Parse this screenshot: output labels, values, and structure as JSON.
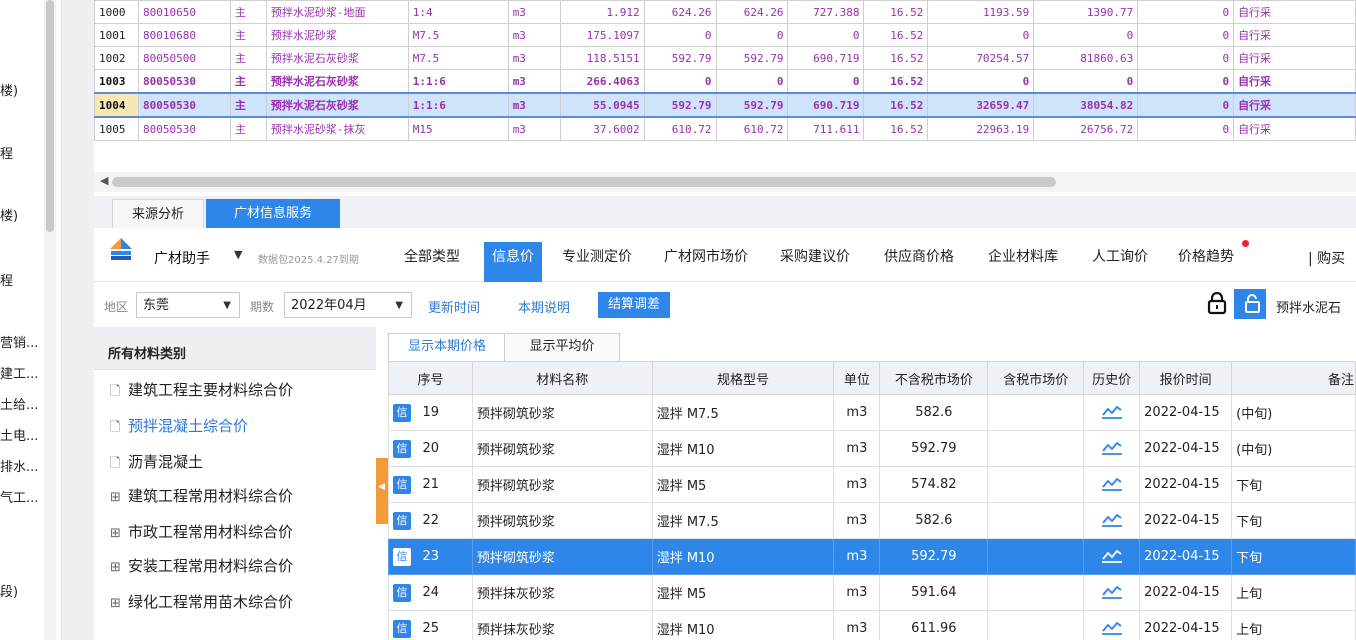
{
  "left_strip": {
    "labels": [
      "楼)",
      "程",
      "楼)",
      "程",
      "营销...",
      "建工...",
      "土给...",
      "土电...",
      "排水...",
      "气工...",
      "段)"
    ]
  },
  "top_grid": {
    "rows": [
      {
        "seq": "1000",
        "code": "80010650",
        "type": "主",
        "name": "预拌水泥砂浆-地面",
        "spec": "1:4",
        "unit": "m3",
        "qty": "1.912",
        "v1": "624.26",
        "v2": "624.26",
        "v3": "727.388",
        "v4": "16.52",
        "v5": "1193.59",
        "v6": "1390.77",
        "v7": "0",
        "note": "自行采"
      },
      {
        "seq": "1001",
        "code": "80010680",
        "type": "主",
        "name": "预拌水泥砂浆",
        "spec": "M7.5",
        "unit": "m3",
        "qty": "175.1097",
        "v1": "0",
        "v2": "0",
        "v3": "0",
        "v4": "16.52",
        "v5": "0",
        "v6": "0",
        "v7": "0",
        "note": "自行采"
      },
      {
        "seq": "1002",
        "code": "80050500",
        "type": "主",
        "name": "预拌水泥石灰砂浆",
        "spec": "M7.5",
        "unit": "m3",
        "qty": "118.5151",
        "v1": "592.79",
        "v2": "592.79",
        "v3": "690.719",
        "v4": "16.52",
        "v5": "70254.57",
        "v6": "81860.63",
        "v7": "0",
        "note": "自行采"
      },
      {
        "seq": "1003",
        "code": "80050530",
        "type": "主",
        "name": "预拌水泥石灰砂浆",
        "spec": "1:1:6",
        "unit": "m3",
        "qty": "266.4063",
        "v1": "0",
        "v2": "0",
        "v3": "0",
        "v4": "16.52",
        "v5": "0",
        "v6": "0",
        "v7": "0",
        "note": "自行采"
      },
      {
        "seq": "1004",
        "code": "80050530",
        "type": "主",
        "name": "预拌水泥石灰砂浆",
        "spec": "1:1:6",
        "unit": "m3",
        "qty": "55.0945",
        "v1": "592.79",
        "v2": "592.79",
        "v3": "690.719",
        "v4": "16.52",
        "v5": "32659.47",
        "v6": "38054.82",
        "v7": "0",
        "note": "自行采"
      },
      {
        "seq": "1005",
        "code": "80050530",
        "type": "主",
        "name": "预拌水泥砂浆-抹灰",
        "spec": "M15",
        "unit": "m3",
        "qty": "37.6002",
        "v1": "610.72",
        "v2": "610.72",
        "v3": "711.611",
        "v4": "16.52",
        "v5": "22963.19",
        "v6": "26756.72",
        "v7": "0",
        "note": "自行采"
      }
    ],
    "bold_rows": [
      3,
      4
    ],
    "selected_row": 4
  },
  "bottom_tabs": {
    "source": "来源分析",
    "guangcai": "广材信息服务"
  },
  "toolbar": {
    "app_name": "广材助手",
    "dropdown_caret": "▼",
    "package_info": "数据包2025.4.27到期",
    "nav": [
      "全部类型",
      "信息价",
      "专业测定价",
      "广材网市场价",
      "采购建议价",
      "供应商价格",
      "企业材料库",
      "人工询价",
      "价格趋势"
    ],
    "active_nav": 1,
    "buy_label": "| 购买"
  },
  "filter": {
    "region_label": "地区",
    "region_value": "东莞",
    "period_label": "期数",
    "period_value": "2022年04月",
    "update_time": "更新时间",
    "period_note": "本期说明",
    "settle_adjust": "结算调差",
    "search_text": "预拌水泥石"
  },
  "category": {
    "header": "所有材料类别",
    "items": [
      {
        "icon": "🗋",
        "label": "建筑工程主要材料综合价"
      },
      {
        "icon": "🗋",
        "label": "预拌混凝土综合价"
      },
      {
        "icon": "🗋",
        "label": "沥青混凝土"
      },
      {
        "icon": "⊞",
        "label": "建筑工程常用材料综合价"
      },
      {
        "icon": "⊞",
        "label": "市政工程常用材料综合价"
      },
      {
        "icon": "⊞",
        "label": "安装工程常用材料综合价"
      },
      {
        "icon": "⊞",
        "label": "绿化工程常用苗木综合价"
      }
    ],
    "highlight_index": 1
  },
  "price_table": {
    "subtabs": [
      "显示本期价格",
      "显示平均价"
    ],
    "headers": [
      "序号",
      "材料名称",
      "规格型号",
      "单位",
      "不含税市场价",
      "含税市场价",
      "历史价",
      "报价时间",
      "备注"
    ],
    "badge": "信",
    "rows": [
      {
        "seq": "19",
        "name": "预拌砌筑砂浆",
        "spec": "湿拌 M7.5",
        "unit": "m3",
        "price": "582.6",
        "tax_price": "",
        "date": "2022-04-15",
        "note": "(中旬)"
      },
      {
        "seq": "20",
        "name": "预拌砌筑砂浆",
        "spec": "湿拌 M10",
        "unit": "m3",
        "price": "592.79",
        "tax_price": "",
        "date": "2022-04-15",
        "note": "(中旬)"
      },
      {
        "seq": "21",
        "name": "预拌砌筑砂浆",
        "spec": "湿拌 M5",
        "unit": "m3",
        "price": "574.82",
        "tax_price": "",
        "date": "2022-04-15",
        "note": "下旬"
      },
      {
        "seq": "22",
        "name": "预拌砌筑砂浆",
        "spec": "湿拌 M7.5",
        "unit": "m3",
        "price": "582.6",
        "tax_price": "",
        "date": "2022-04-15",
        "note": "下旬"
      },
      {
        "seq": "23",
        "name": "预拌砌筑砂浆",
        "spec": "湿拌 M10",
        "unit": "m3",
        "price": "592.79",
        "tax_price": "",
        "date": "2022-04-15",
        "note": "下旬"
      },
      {
        "seq": "24",
        "name": "预拌抹灰砂浆",
        "spec": "湿拌 M5",
        "unit": "m3",
        "price": "591.64",
        "tax_price": "",
        "date": "2022-04-15",
        "note": "上旬"
      },
      {
        "seq": "25",
        "name": "预拌抹灰砂浆",
        "spec": "湿拌 M10",
        "unit": "m3",
        "price": "611.96",
        "tax_price": "",
        "date": "2022-04-15",
        "note": "上旬"
      }
    ],
    "selected_row": 4
  },
  "colors": {
    "accent": "#2d86e8",
    "purple_text": "#9a2fb0",
    "orange": "#f59a3a"
  }
}
